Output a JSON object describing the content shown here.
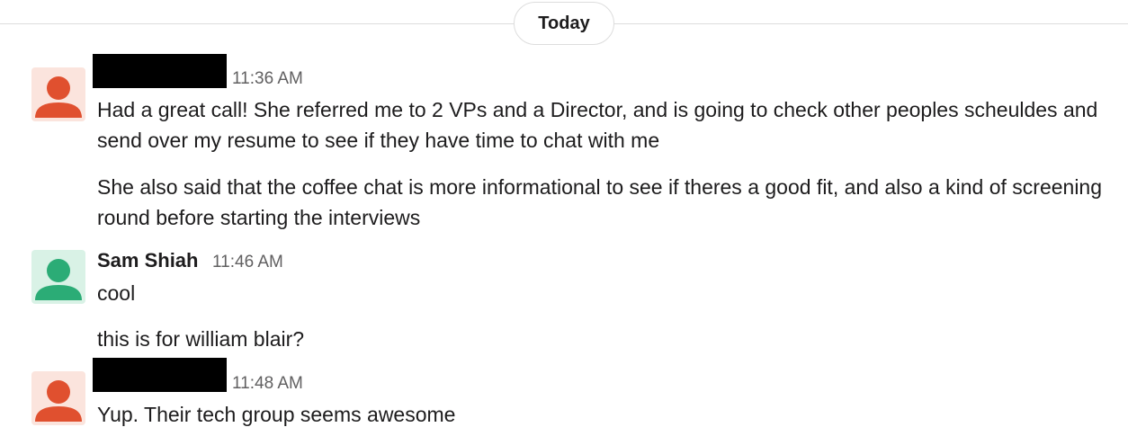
{
  "date_divider": {
    "label": "Today"
  },
  "colors": {
    "avatar_orange": "#e0502f",
    "avatar_orange_bg": "#fbe4dd",
    "avatar_green": "#2bac76",
    "avatar_green_bg": "#d9f2e6"
  },
  "messages": [
    {
      "sender_redacted": true,
      "time": "11:36 AM",
      "avatar_icon": "person-icon",
      "lines": [
        "Had a great call! She referred me to 2 VPs and a Director, and is going to check other peoples scheuldes and send over my resume to see if they have time to chat with me",
        "She also said that the coffee chat is more informational to see if theres a good fit, and also a kind of screening round before starting the interviews"
      ]
    },
    {
      "sender": "Sam Shiah",
      "time": "11:46 AM",
      "avatar_icon": "person-icon",
      "lines": [
        "cool",
        "this is for william blair?"
      ]
    },
    {
      "sender_redacted": true,
      "time": "11:48 AM",
      "avatar_icon": "person-icon",
      "lines": [
        "Yup. Their tech group seems awesome"
      ]
    }
  ]
}
